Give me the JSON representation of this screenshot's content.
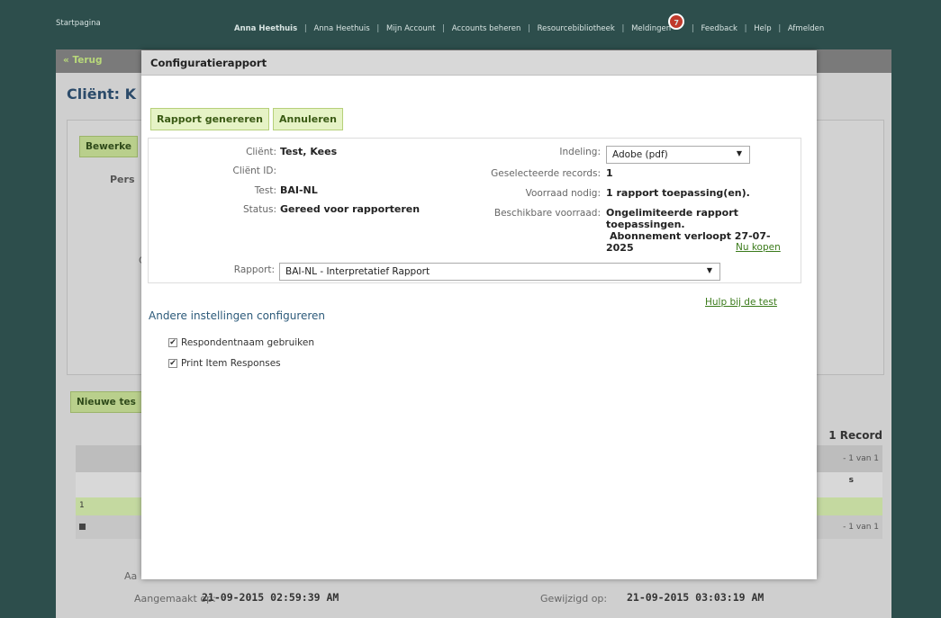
{
  "topnav": {
    "home": "Startpagina",
    "user": "Anna Heethuis",
    "links": [
      "Anna Heethuis",
      "Mijn Account",
      "Accounts beheren",
      "Resourcebibliotheek",
      "Meldingen",
      "Feedback",
      "Help",
      "Afmelden"
    ],
    "notification_count": "7"
  },
  "background": {
    "back_label": "« Terug",
    "client_title": "Cliënt: K",
    "edit_button": "Bewerke",
    "pers_label": "Pers",
    "c_label": "C",
    "new_test_button": "Nieuwe tes",
    "records": "1 Record",
    "page_info_top": "- 1 van 1",
    "page_info_bottom": "- 1 van 1",
    "row_number": "1",
    "s_letter": "s",
    "created_by_label": "Aa",
    "created_on_label": "Aangemaakt op:",
    "created_on_value": "21-09-2015 02:59:39 AM",
    "modified_on_label": "Gewijzigd op:",
    "modified_on_value": "21-09-2015 03:03:19 AM"
  },
  "modal": {
    "title": "Configuratierapport",
    "generate_button": "Rapport genereren",
    "cancel_button": "Annuleren",
    "fields": {
      "client_label": "Cliënt:",
      "client_value": "Test, Kees",
      "client_id_label": "Cliënt ID:",
      "client_id_value": "",
      "test_label": "Test:",
      "test_value": "BAI-NL",
      "status_label": "Status:",
      "status_value": "Gereed voor rapporteren",
      "format_label": "Indeling:",
      "format_value": "Adobe (pdf)",
      "selected_label": "Geselecteerde records:",
      "selected_value": "1",
      "stock_needed_label": "Voorraad nodig:",
      "stock_needed_value": "1 rapport toepassing(en).",
      "stock_available_label": "Beschikbare voorraad:",
      "stock_available_line1": "Ongelimiteerde rapport",
      "stock_available_line2": "toepassingen.",
      "stock_available_line3": "Abonnement verloopt 27-07-",
      "stock_available_line4": "2025",
      "buy_now": "Nu kopen",
      "report_label": "Rapport:",
      "report_value": "BAI-NL - Interpretatief Rapport"
    },
    "help_link": "Hulp bij de test",
    "other_settings": "Andere instellingen configureren",
    "options": [
      {
        "label": "Respondentnaam gebruiken",
        "checked": true
      },
      {
        "label": "Print Item Responses",
        "checked": true
      }
    ]
  }
}
